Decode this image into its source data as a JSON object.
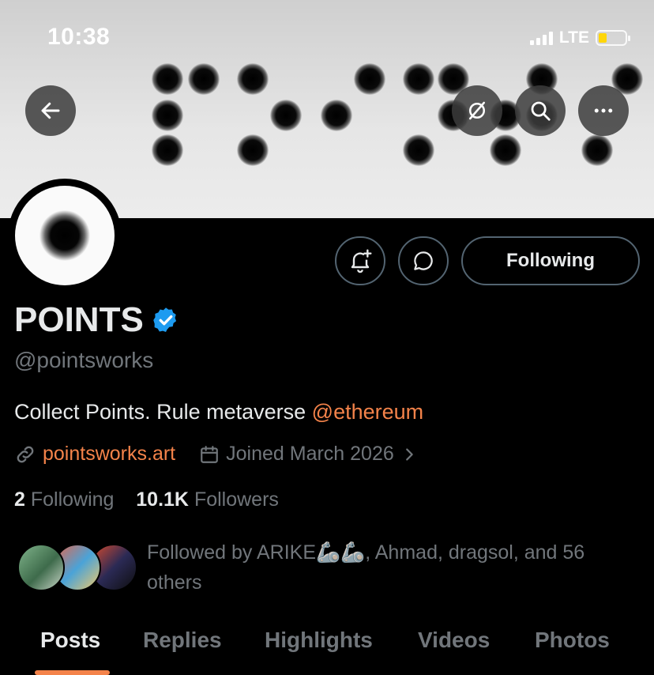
{
  "status_bar": {
    "time": "10:38",
    "network": "LTE",
    "battery_color": "#ffd60a"
  },
  "header": {
    "back_icon": "arrow-left-icon",
    "actions": [
      "hide-media-icon",
      "search-icon",
      "more-icon"
    ]
  },
  "profile": {
    "name": "POINTS",
    "verified": true,
    "handle": "@pointsworks",
    "bio_text": "Collect Points. Rule metaverse ",
    "bio_mention": "@ethereum",
    "website": "pointsworks.art",
    "joined": "Joined March 2026",
    "following_count": "2",
    "following_label": "Following",
    "followers_count": "10.1K",
    "followers_label": "Followers",
    "followed_by": "Followed by ARIKE🦾🦾, Ahmad, dragsol, and 56 others"
  },
  "actions": {
    "notify_icon": "bell-plus-icon",
    "message_icon": "message-icon",
    "following_button": "Following"
  },
  "tabs": [
    "Posts",
    "Replies",
    "Highlights",
    "Videos",
    "Photos"
  ],
  "active_tab": "Posts",
  "colors": {
    "accent": "#f4834a",
    "verified": "#1d9bf0",
    "muted": "#71767b",
    "background": "#000000"
  }
}
